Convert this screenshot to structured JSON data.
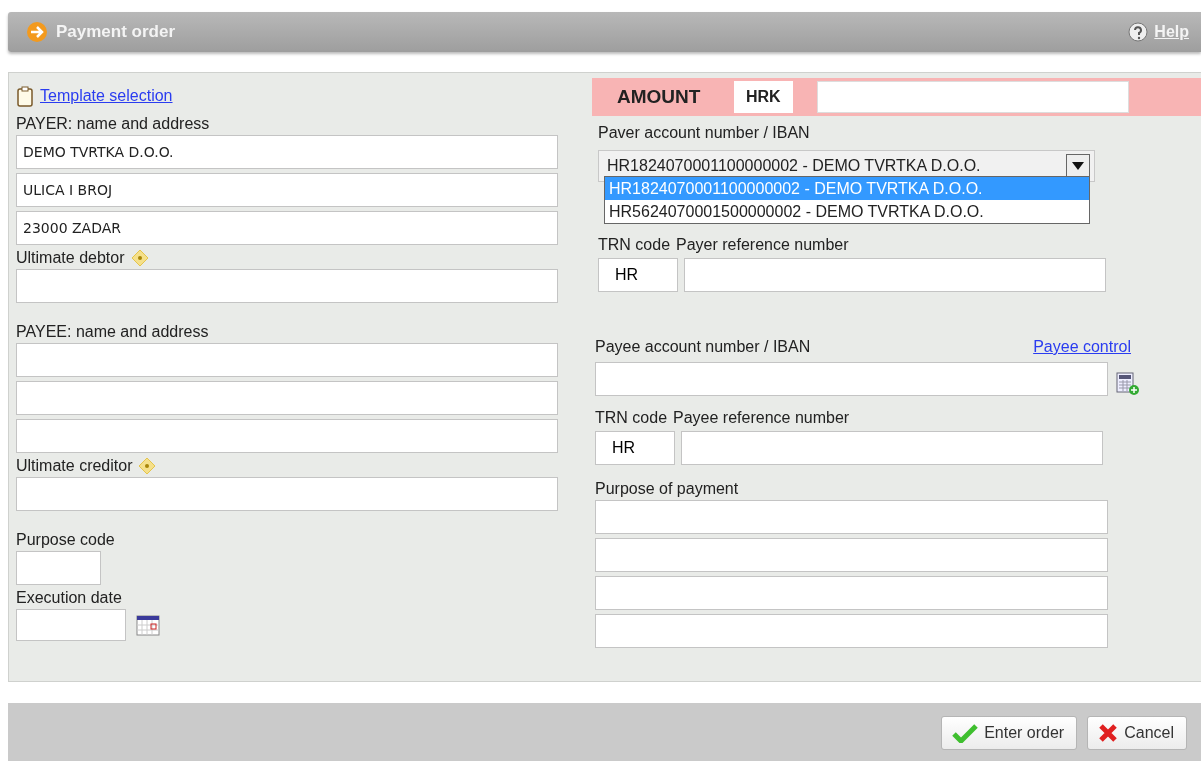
{
  "window": {
    "title": "Payment order",
    "help": "Help"
  },
  "template_link": "Template selection",
  "payer": {
    "label": "PAYER: name and address",
    "lines": [
      {
        "kind": "text",
        "value": "DEMO TVRTKA D.O.O."
      },
      {
        "kind": "text",
        "value": "ULICA I BROJ"
      },
      {
        "kind": "text",
        "value": "23000 ZADAR"
      }
    ]
  },
  "ultimate_debtor": {
    "label": "Ultimate debtor"
  },
  "payee": {
    "label": "PAYEE: name and address",
    "lines": [
      {
        "kind": "text"
      },
      {
        "kind": "text"
      },
      {
        "kind": "text"
      }
    ]
  },
  "ultimate_creditor": {
    "label": "Ultimate creditor"
  },
  "purpose_code": {
    "label": "Purpose code"
  },
  "execution_date": {
    "label": "Execution date"
  },
  "amount": {
    "label": "AMOUNT",
    "currency": "HRK"
  },
  "payer_account": {
    "label": "Paver account number / IBAN",
    "value": "HR1824070001100000002 - DEMO TVRTKA D.O.O.",
    "expanded": true,
    "options": [
      {
        "text": "HR1824070001100000002 - DEMO TVRTKA D.O.O.",
        "selected": true
      },
      {
        "text": "HR5624070001500000002 - DEMO TVRTKA D.O.O.",
        "selected": false
      }
    ]
  },
  "payer_reference": {
    "trn_label": "TRN code",
    "label": "Payer reference number",
    "trn_value": "HR"
  },
  "payee_account": {
    "label": "Payee account number / IBAN",
    "link": "Payee control"
  },
  "payee_reference": {
    "trn_label": "TRN code",
    "label": "Payee reference number",
    "trn_value": "HR"
  },
  "purpose_of_payment": {
    "label": "Purpose of payment",
    "lines": [
      {
        "kind": "text"
      },
      {
        "kind": "text"
      },
      {
        "kind": "text"
      },
      {
        "kind": "text"
      }
    ]
  },
  "buttons": [
    {
      "kind": "confirm",
      "label": "Enter order"
    },
    {
      "kind": "cancel",
      "label": "Cancel"
    }
  ]
}
